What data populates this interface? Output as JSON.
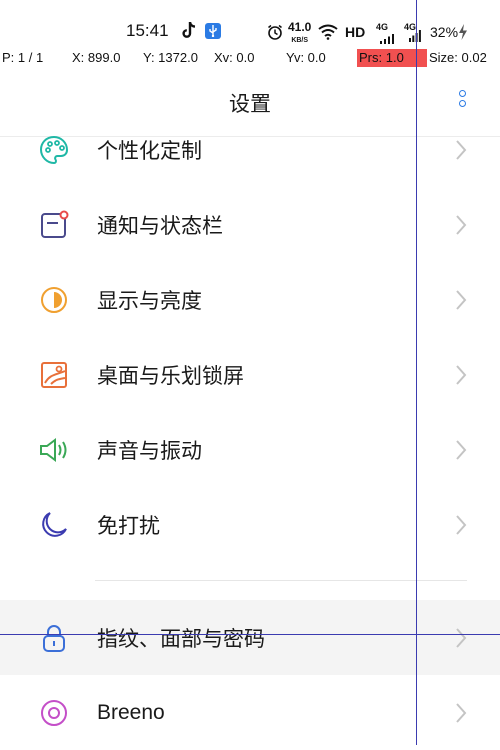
{
  "status_bar": {
    "time": "15:41",
    "net_speed_value": "41.0",
    "net_speed_unit": "KB/S",
    "hd_label": "HD",
    "net1": "4G",
    "net2": "4G",
    "battery": "32%"
  },
  "pointer_info": {
    "p": "P: 1 / 1",
    "x": "X: 899.0",
    "y": "Y: 1372.0",
    "xv": "Xv: 0.0",
    "yv": "Yv: 0.0",
    "prs": "Prs: 1.0",
    "size": "Size: 0.02"
  },
  "header": {
    "title": "设置"
  },
  "menu": [
    {
      "label": "个性化定制",
      "icon": "palette-icon"
    },
    {
      "label": "通知与状态栏",
      "icon": "notification-icon"
    },
    {
      "label": "显示与亮度",
      "icon": "brightness-icon"
    },
    {
      "label": "桌面与乐划锁屏",
      "icon": "wallpaper-icon"
    },
    {
      "label": "声音与振动",
      "icon": "speaker-icon"
    },
    {
      "label": "免打扰",
      "icon": "moon-icon"
    },
    {
      "label": "指纹、面部与密码",
      "icon": "lock-icon"
    },
    {
      "label": "Breeno",
      "icon": "breeno-icon"
    }
  ],
  "colors": {
    "accent": "#2b7be4",
    "pressure_bar": "#f15050",
    "palette": "#1fb8a6",
    "notification": "#4a4a8c",
    "brightness": "#f0a030",
    "wallpaper": "#e8703a",
    "speaker": "#3aa856",
    "moon": "#3b3bb0",
    "lock": "#3b6fd8",
    "breeno": "#c44fc8"
  }
}
